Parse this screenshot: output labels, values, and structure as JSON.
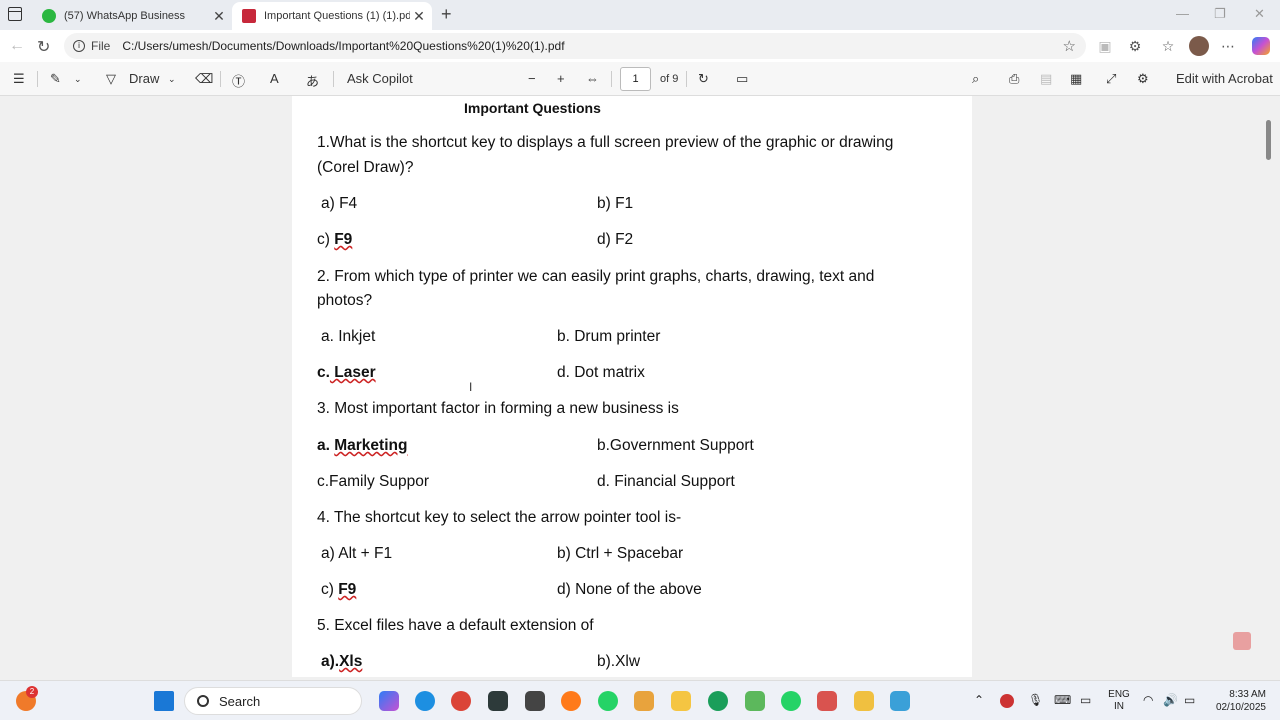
{
  "tabs": [
    {
      "label": "(57) WhatsApp Business"
    },
    {
      "label": "Important Questions (1) (1).pdf"
    }
  ],
  "address": {
    "scheme": "File",
    "url": "C:/Users/umesh/Documents/Downloads/Important%20Questions%20(1)%20(1).pdf"
  },
  "pdf_toolbar": {
    "draw": "Draw",
    "ask_copilot": "Ask Copilot",
    "page": "1",
    "of_pages": "of 9",
    "edit_acrobat": "Edit with Acrobat"
  },
  "document": {
    "title": "Important Questions",
    "q1": {
      "line1": "1.What is the shortcut key to displays a full screen preview of the graphic or drawing",
      "line2": "(Corel Draw)?",
      "a": "a) F4",
      "b": "b) F1",
      "c_prefix": "c) ",
      "c_answer": "F9",
      "d": "d) F2"
    },
    "q2": {
      "line1": "2. From which type of printer we can easily print graphs, charts, drawing, text and",
      "line2": "photos?",
      "a": "a. Inkjet",
      "b": "b. Drum printer",
      "c_prefix": "c.",
      "c_answer": " Laser",
      "d": "d. Dot matrix"
    },
    "q3": {
      "line1": "3. Most important factor in forming a new business is",
      "a_prefix": "a. ",
      "a_answer": "Marketing",
      "b": "b.Government Support",
      "c": "c.Family Suppor",
      "d": "d. Financial Support"
    },
    "q4": {
      "line1": "4. The shortcut key to select the arrow pointer tool is-",
      "a": "a) Alt + F1",
      "b": "b) Ctrl + Spacebar",
      "c_prefix": "c) ",
      "c_answer": "F9",
      "d": "d) None of the above"
    },
    "q5": {
      "line1": "5. Excel files have a default extension of",
      "a_prefix": "a).",
      "a_answer": "Xls",
      "b": "b).Xlw"
    }
  },
  "taskbar": {
    "search": "Search",
    "badge": "2",
    "lang1": "ENG",
    "lang2": "IN",
    "time": "8:33 AM",
    "date": "02/10/2025"
  }
}
